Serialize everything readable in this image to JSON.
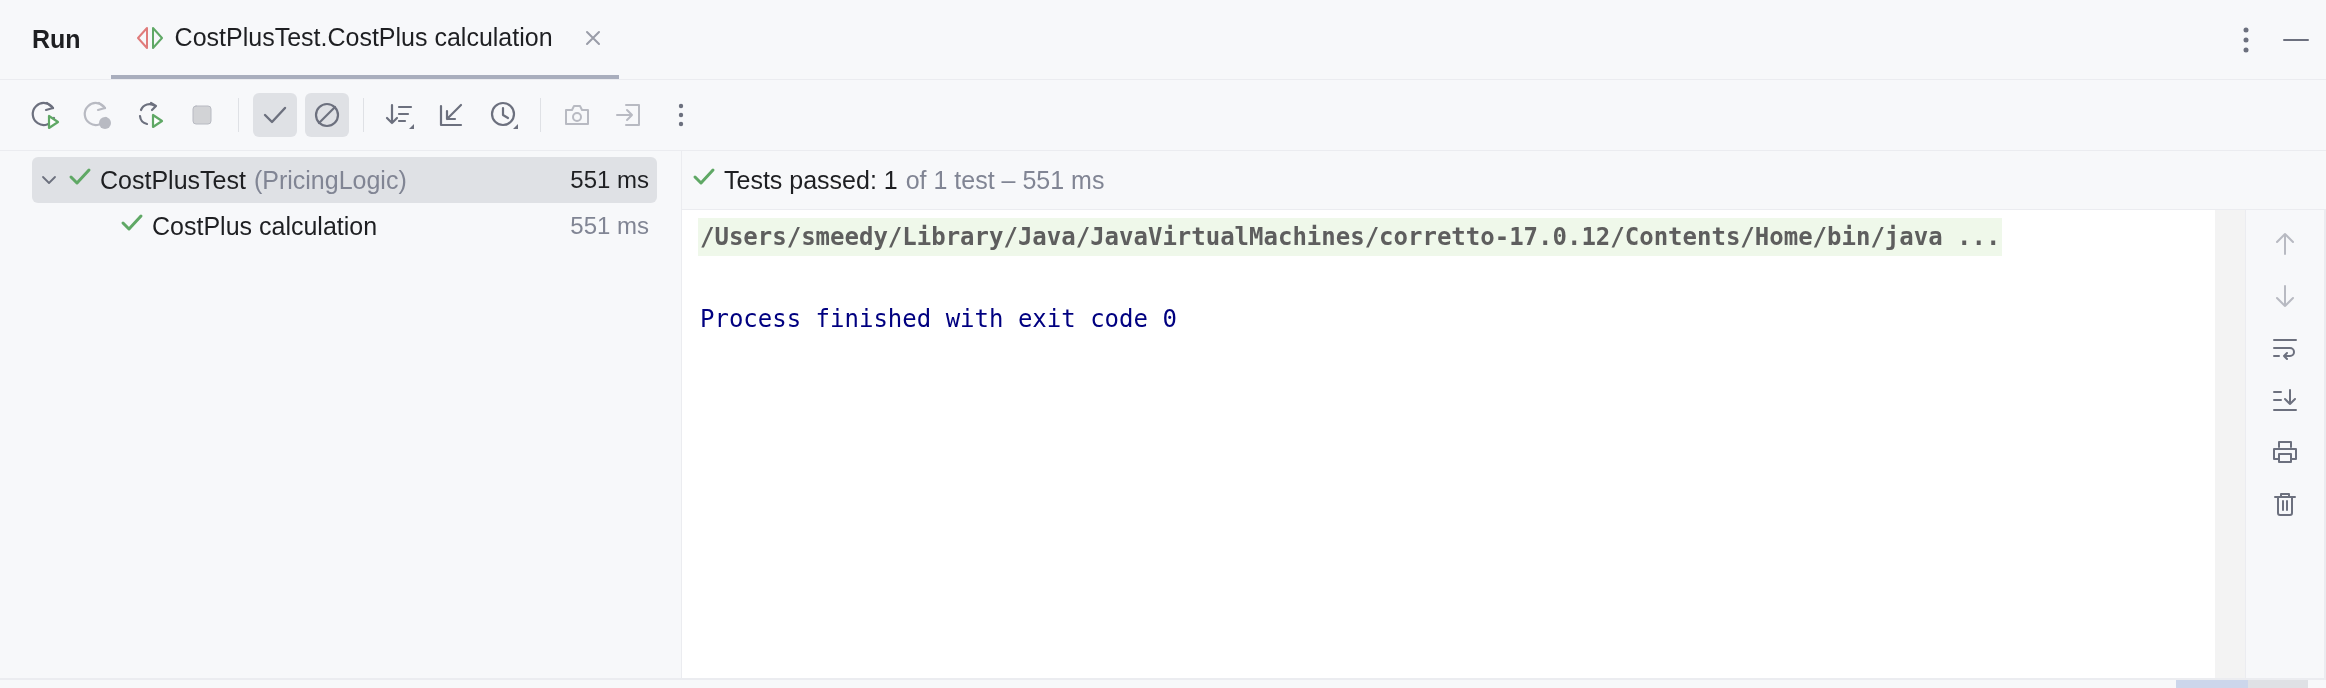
{
  "panel": {
    "title": "Run"
  },
  "tabs": [
    {
      "label": "CostPlusTest.CostPlus calculation",
      "selected": true
    }
  ],
  "toolbar": [
    {
      "kind": "rerun",
      "disabled": false
    },
    {
      "kind": "rerun-failed",
      "disabled": true
    },
    {
      "kind": "auto-rerun",
      "disabled": false
    },
    {
      "kind": "stop",
      "disabled": true
    },
    {
      "kind": "separator"
    },
    {
      "kind": "show-passed",
      "disabled": false,
      "selected": true
    },
    {
      "kind": "show-ignored",
      "disabled": false,
      "selected": true
    },
    {
      "kind": "separator"
    },
    {
      "kind": "sort",
      "disabled": false
    },
    {
      "kind": "collapse",
      "disabled": false
    },
    {
      "kind": "history",
      "disabled": false
    },
    {
      "kind": "separator"
    },
    {
      "kind": "camera",
      "disabled": true
    },
    {
      "kind": "import",
      "disabled": true
    },
    {
      "kind": "more",
      "disabled": false
    }
  ],
  "tree": [
    {
      "name": "CostPlusTest",
      "detail": "(PricingLogic)",
      "time": "551 ms",
      "passed": true,
      "selected": true,
      "expanded": true,
      "children": [
        {
          "name": "CostPlus calculation",
          "time": "551 ms",
          "passed": true,
          "selected": false
        }
      ]
    }
  ],
  "status": {
    "passed": true,
    "label": "Tests passed:",
    "count": "1",
    "rest": "of 1 test – 551 ms"
  },
  "console": [
    {
      "kind": "command",
      "text": "/Users/smeedy/Library/Java/JavaVirtualMachines/corretto-17.0.12/Contents/Home/bin/java ..."
    },
    {
      "kind": "system",
      "text": "Process finished with exit code 0"
    }
  ],
  "side_tools": [
    {
      "kind": "up",
      "disabled": true
    },
    {
      "kind": "down",
      "disabled": true
    },
    {
      "kind": "wrap",
      "disabled": false
    },
    {
      "kind": "scroll-end",
      "disabled": false
    },
    {
      "kind": "print",
      "disabled": false
    },
    {
      "kind": "trash",
      "disabled": false
    }
  ]
}
